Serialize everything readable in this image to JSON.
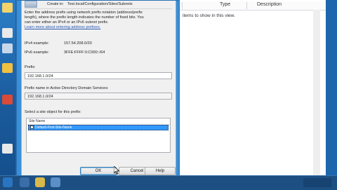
{
  "dialog": {
    "create_in_label": "Create in:",
    "create_in_value": "Test.local/Configuration/Sites/Subnets",
    "instructions": [
      "Enter the address prefix using network prefix notation (address/prefix",
      "length), where the prefix length indicates the number of fixed bits. You",
      "can enter either an IPv4 or an IPv6 subnet prefix."
    ],
    "learn_more_link": "Learn more about entering address prefixes.",
    "ipv4_example_label": "IPv4 example:",
    "ipv4_example_value": "157.54.208.0/20",
    "ipv6_example_label": "IPv6 example:",
    "ipv6_example_value": "3FFE:FFFF:0:C000::/64",
    "prefix_label": "Prefix:",
    "prefix_value": "192.168.1.0/24",
    "prefix_name_label": "Prefix name in Active Directory Domain Services:",
    "prefix_name_value": "192.168.1.0/24",
    "site_select_label": "Select a site object for this prefix:",
    "site_list_header": "Site Name",
    "site_list_items": [
      "Default-First-Site-Name"
    ],
    "ok_label": "OK",
    "cancel_label": "Cancel",
    "help_label": "Help"
  },
  "background_window": {
    "columns": [
      "Type",
      "Description"
    ],
    "empty_message": "items to show in this view."
  },
  "colors": {
    "desktop": "#1b63a8",
    "dialog_frame": "#3a8fd6",
    "selection": "#3399ff"
  }
}
